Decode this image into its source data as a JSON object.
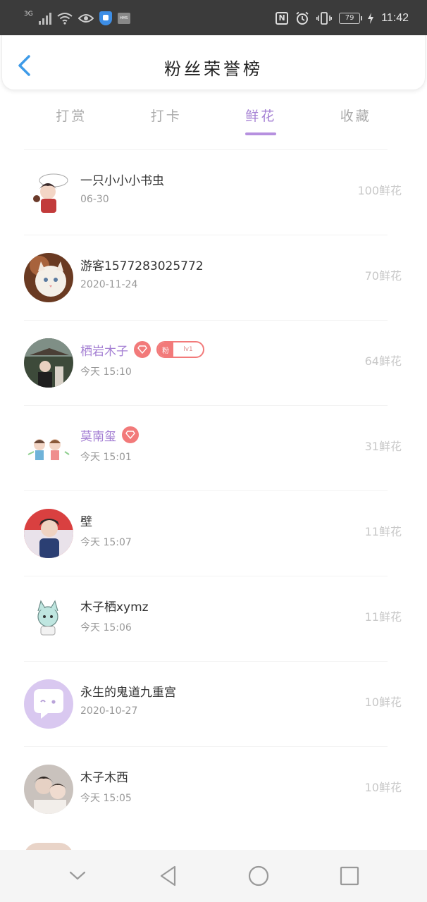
{
  "status_bar": {
    "network": "3G",
    "battery": "79",
    "time": "11:42",
    "hms_label": "HMS",
    "icons": [
      "signal-icon",
      "wifi-icon",
      "eye-icon",
      "shield-icon",
      "hms-icon",
      "nfc-icon",
      "alarm-icon",
      "vibrate-icon",
      "battery-icon",
      "charging-icon"
    ]
  },
  "header": {
    "title": "粉丝荣誉榜",
    "back_icon": "chevron-left-icon"
  },
  "tabs": [
    {
      "label": "打赏",
      "active": false
    },
    {
      "label": "打卡",
      "active": false
    },
    {
      "label": "鲜花",
      "active": true
    },
    {
      "label": "收藏",
      "active": false
    }
  ],
  "accent_color": "#a47fd3",
  "badge_color": "#f27a7a",
  "entries": [
    {
      "name": "一只小小小书虫",
      "date": "06-30",
      "amount": "100鲜花",
      "vip": false
    },
    {
      "name": "游客1577283025772",
      "date": "2020-11-24",
      "amount": "70鲜花",
      "vip": false
    },
    {
      "name": "栖岩木子",
      "date": "今天 15:10",
      "amount": "64鲜花",
      "vip": true,
      "gem_badge": true,
      "fan_badge": {
        "label": "粉",
        "level": "lv1"
      }
    },
    {
      "name": "莫南玺",
      "date": "今天 15:01",
      "amount": "31鲜花",
      "vip": true,
      "gem_badge": true
    },
    {
      "name": "壁",
      "date": "今天 15:07",
      "amount": "11鲜花",
      "vip": false
    },
    {
      "name": "木子栖xymz",
      "date": "今天 15:06",
      "amount": "11鲜花",
      "vip": false
    },
    {
      "name": "永生的鬼道九重宫",
      "date": "2020-10-27",
      "amount": "10鲜花",
      "vip": false
    },
    {
      "name": "木子木西",
      "date": "今天 15:05",
      "amount": "10鲜花",
      "vip": false
    }
  ],
  "nav_bar": {
    "buttons": [
      "collapse-icon",
      "back-triangle-icon",
      "home-circle-icon",
      "recents-square-icon"
    ]
  }
}
